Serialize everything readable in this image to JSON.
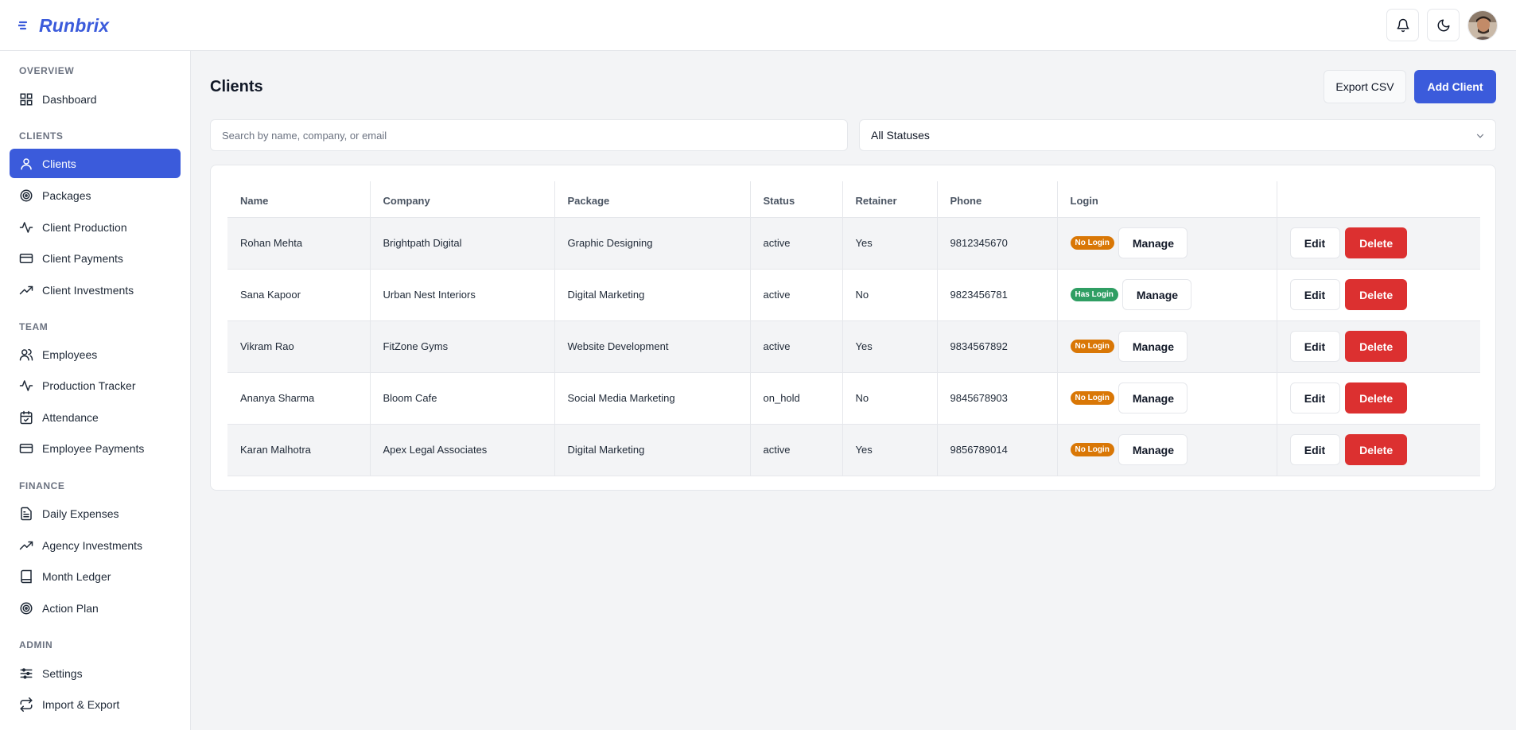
{
  "brand": {
    "name": "Runbrix",
    "color": "#3b5bdb"
  },
  "header": {
    "notifications_icon": "bell-icon",
    "theme_icon": "moon-icon",
    "avatar": "user-avatar"
  },
  "sidebar": {
    "sections": [
      {
        "label": "OVERVIEW",
        "items": [
          {
            "label": "Dashboard",
            "icon": "grid-icon"
          }
        ]
      },
      {
        "label": "CLIENTS",
        "items": [
          {
            "label": "Clients",
            "icon": "user-icon",
            "active": true
          },
          {
            "label": "Packages",
            "icon": "target-icon"
          },
          {
            "label": "Client Production",
            "icon": "activity-icon"
          },
          {
            "label": "Client Payments",
            "icon": "card-icon"
          },
          {
            "label": "Client Investments",
            "icon": "trending-up-icon"
          }
        ]
      },
      {
        "label": "TEAM",
        "items": [
          {
            "label": "Employees",
            "icon": "users-icon"
          },
          {
            "label": "Production Tracker",
            "icon": "activity-icon"
          },
          {
            "label": "Attendance",
            "icon": "calendar-check-icon"
          },
          {
            "label": "Employee Payments",
            "icon": "card-icon"
          }
        ]
      },
      {
        "label": "FINANCE",
        "items": [
          {
            "label": "Daily Expenses",
            "icon": "file-text-icon"
          },
          {
            "label": "Agency Investments",
            "icon": "trending-up-icon"
          },
          {
            "label": "Month Ledger",
            "icon": "book-icon"
          },
          {
            "label": "Action Plan",
            "icon": "target-icon"
          }
        ]
      },
      {
        "label": "ADMIN",
        "items": [
          {
            "label": "Settings",
            "icon": "sliders-icon"
          },
          {
            "label": "Import & Export",
            "icon": "repeat-icon"
          }
        ]
      }
    ]
  },
  "main": {
    "title": "Clients",
    "export_label": "Export CSV",
    "add_label": "Add Client",
    "search_placeholder": "Search by name, company, or email",
    "status_filter": "All Statuses",
    "table": {
      "headers": [
        "Name",
        "Company",
        "Package",
        "Status",
        "Retainer",
        "Phone",
        "Login",
        ""
      ],
      "manage_label": "Manage",
      "edit_label": "Edit",
      "delete_label": "Delete",
      "rows": [
        {
          "name": "Rohan Mehta",
          "company": "Brightpath Digital",
          "package": "Graphic Designing",
          "status": "active",
          "retainer": "Yes",
          "phone": "9812345670",
          "login": "No Login",
          "has_login": false
        },
        {
          "name": "Sana Kapoor",
          "company": "Urban Nest Interiors",
          "package": "Digital Marketing",
          "status": "active",
          "retainer": "No",
          "phone": "9823456781",
          "login": "Has Login",
          "has_login": true
        },
        {
          "name": "Vikram Rao",
          "company": "FitZone Gyms",
          "package": "Website Development",
          "status": "active",
          "retainer": "Yes",
          "phone": "9834567892",
          "login": "No Login",
          "has_login": false
        },
        {
          "name": "Ananya Sharma",
          "company": "Bloom Cafe",
          "package": "Social Media Marketing",
          "status": "on_hold",
          "retainer": "No",
          "phone": "9845678903",
          "login": "No Login",
          "has_login": false
        },
        {
          "name": "Karan Malhotra",
          "company": "Apex Legal Associates",
          "package": "Digital Marketing",
          "status": "active",
          "retainer": "Yes",
          "phone": "9856789014",
          "login": "No Login",
          "has_login": false
        }
      ]
    }
  },
  "colors": {
    "accent": "#3b5bdb",
    "danger": "#dc3030",
    "warning": "#d97706",
    "success": "#2f9e63"
  }
}
